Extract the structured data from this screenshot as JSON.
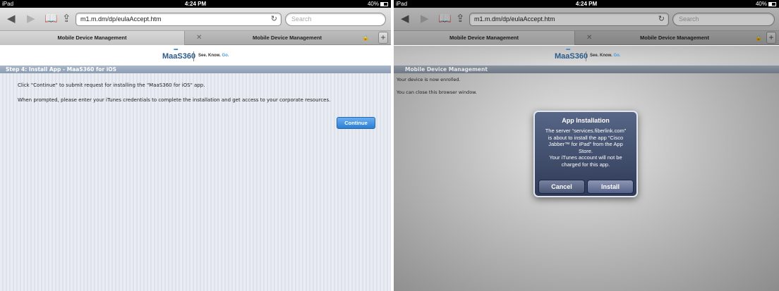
{
  "status_bar": {
    "device": "iPad",
    "time": "4:24 PM",
    "battery": "40%"
  },
  "browser": {
    "url": "m1.m.dm/dp/eulaAccept.htm",
    "search_placeholder": "Search",
    "tabs": [
      {
        "label": "Mobile Device Management"
      },
      {
        "label": "Mobile Device Management"
      }
    ]
  },
  "brand": {
    "logo": "MaaS360",
    "tagline": "See. Know.",
    "tagline_go": "Go."
  },
  "left_page": {
    "step_title": "Step 4: Install App - MaaS360 for iOS",
    "instruction_1": "Click \"Continue\" to submit request for installing the \"MaaS360 for iOS\" app.",
    "instruction_2": "When prompted, please enter your iTunes credentials to complete the installation and get access to your corporate resources.",
    "continue_label": "Continue"
  },
  "right_page": {
    "header": "Mobile Device Management",
    "line_1": "Your device is now enrolled.",
    "line_2": "You can close this browser window.",
    "dialog": {
      "title": "App Installation",
      "message_lines": [
        "The server “services.fiberlink.com”",
        "is about to install the app “Cisco",
        "Jabber™ for iPad” from the App",
        "Store.",
        "Your iTunes account will not be",
        "charged for this app."
      ],
      "cancel_label": "Cancel",
      "install_label": "Install"
    }
  },
  "colors": {
    "accent": "#2c7fd6",
    "header": "#8c9cb2",
    "alert": "#3b4a70"
  }
}
